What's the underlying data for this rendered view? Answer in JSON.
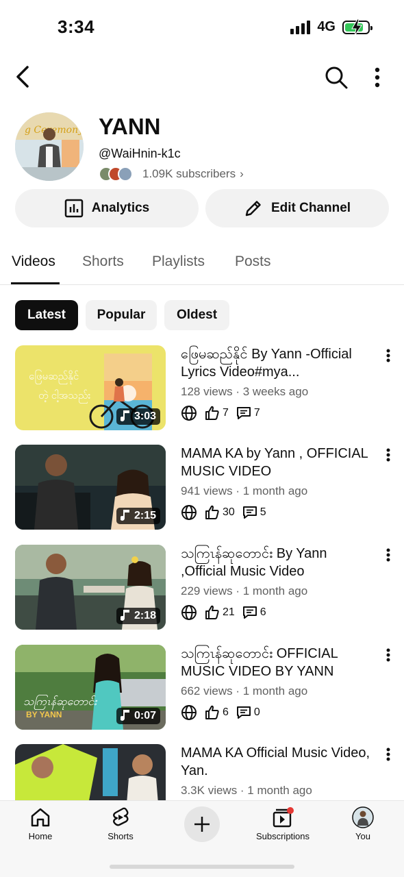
{
  "status_bar": {
    "time": "3:34",
    "network": "4G",
    "battery_level": 0.8,
    "battery_color": "#34c759"
  },
  "channel": {
    "name": "YANN",
    "handle": "@WaiHnin-k1c",
    "subscribers": "1.09K subscribers",
    "avatar_banner_text": "g Ceremony"
  },
  "actions": {
    "analytics": "Analytics",
    "edit_channel": "Edit Channel"
  },
  "tabs": [
    "Videos",
    "Shorts",
    "Playlists",
    "Posts"
  ],
  "active_tab": "Videos",
  "chips": [
    "Latest",
    "Popular",
    "Oldest"
  ],
  "active_chip": "Latest",
  "videos": [
    {
      "title": "ဖြေမဆည်နိုင် By Yann -Official Lyrics Video#mya...",
      "meta": "128 views · 3 weeks ago",
      "duration": "3:03",
      "likes": "7",
      "comments": "7",
      "thumb_text_1": "ဖြေမဆည်နိုင်",
      "thumb_text_2": "တဲ့ ငါ့အသည်း"
    },
    {
      "title": "MAMA KA by Yann , OFFICIAL MUSIC VIDEO",
      "meta": "941 views · 1 month ago",
      "duration": "2:15",
      "likes": "30",
      "comments": "5"
    },
    {
      "title": "သကြၤန်ဆုတောင်း By Yann ,Official Music Video",
      "meta": "229 views · 1 month ago",
      "duration": "2:18",
      "likes": "21",
      "comments": "6"
    },
    {
      "title": "သကြၤန်ဆုတောင်း OFFICIAL MUSIC VIDEO BY YANN",
      "meta": "662 views · 1 month ago",
      "duration": "0:07",
      "likes": "6",
      "comments": "0",
      "thumb_text_1": "သကြၤန်ဆုတောင်း",
      "thumb_text_2": "BY YANN"
    },
    {
      "title": "MAMA KA Official Music Video, Yan.",
      "meta": "3.3K views · 1 month ago"
    }
  ],
  "bottom_nav": {
    "home": "Home",
    "shorts": "Shorts",
    "subscriptions": "Subscriptions",
    "you": "You"
  },
  "icons": [
    "back-arrow-icon",
    "search-icon",
    "more-vert-icon",
    "analytics-icon",
    "pencil-icon",
    "music-note-icon",
    "globe-icon",
    "thumbs-up-icon",
    "comment-icon",
    "home-icon",
    "shorts-icon",
    "plus-icon",
    "subscriptions-icon"
  ]
}
